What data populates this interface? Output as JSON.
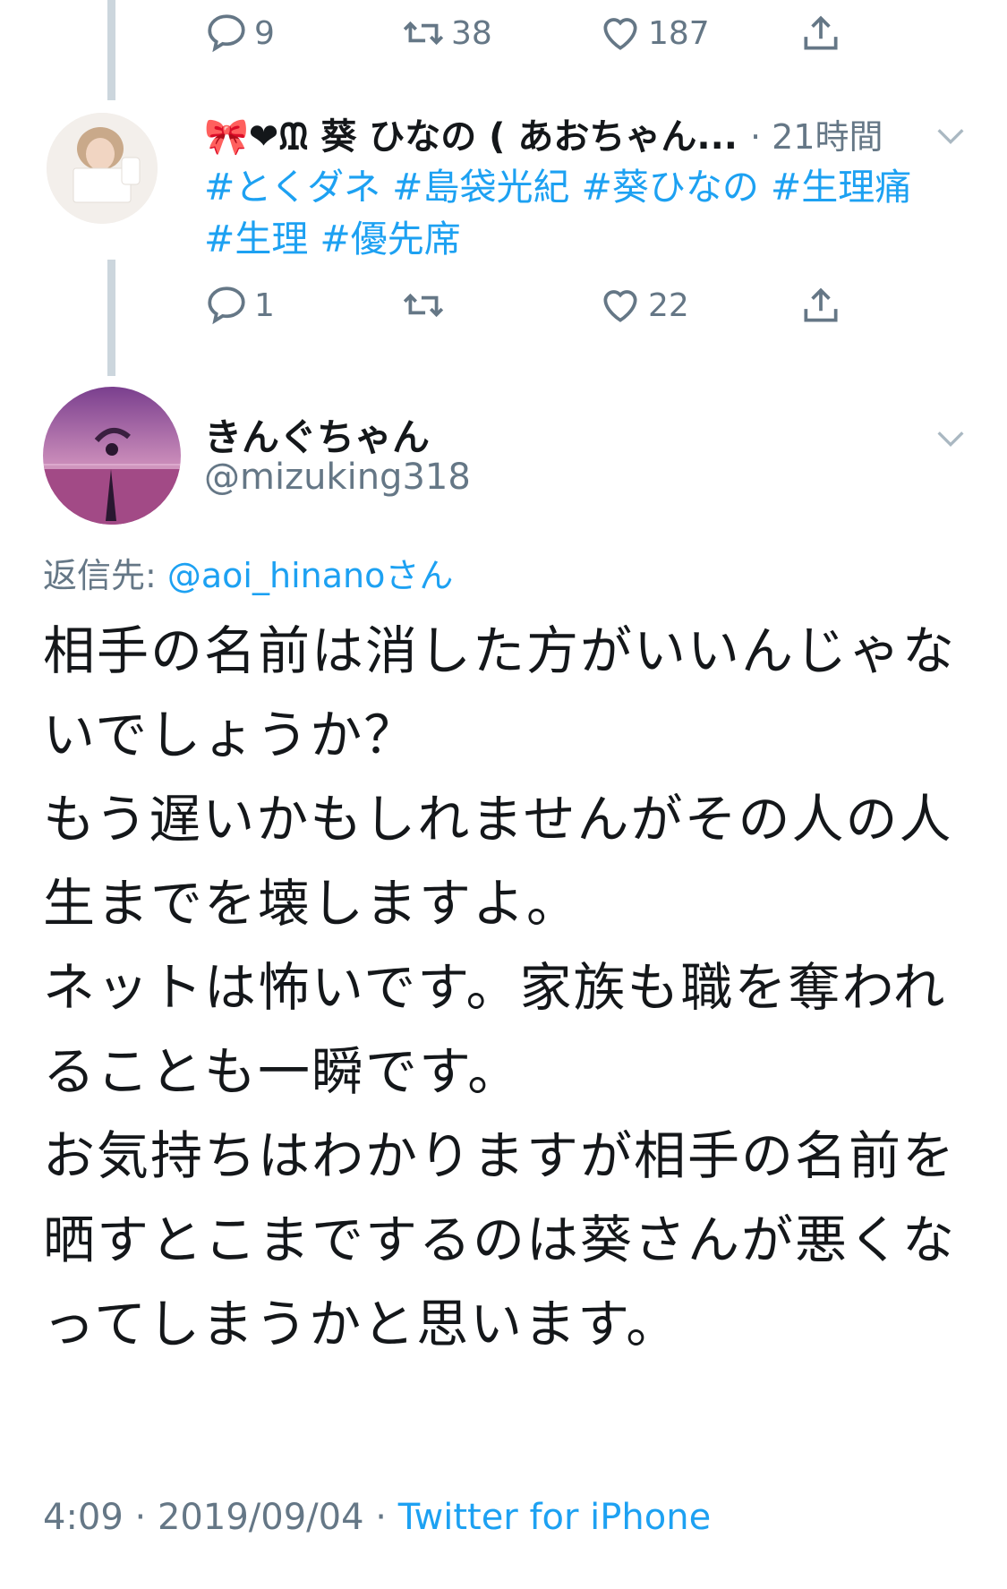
{
  "prev_tweet_actions": {
    "reply_count": "9",
    "retweet_count": "38",
    "like_count": "187"
  },
  "tweet1": {
    "author_name": "🎀❤︎ᙢ 葵 ひなの ( あおちゃん...",
    "time": "· 21時間",
    "text": "#とくダネ #島袋光紀 #葵ひなの #生理痛 #生理 #優先席",
    "reply_count": "1",
    "retweet_count": "",
    "like_count": "22"
  },
  "tweet2": {
    "author_name": "きんぐちゃん",
    "handle": "@mizuking318",
    "reply_label": "返信先: ",
    "reply_target": "@aoi_hinanoさん",
    "text": "相手の名前は消した方がいいんじゃないでしょうか？\nもう遅いかもしれませんがその人の人生までを壊しますよ。\nネットは怖いです。家族も職を奪われることも一瞬です。\nお気持ちはわかりますが相手の名前を晒すとこまでするのは葵さんが悪くなってしまうかと思います。",
    "time": "4:09",
    "date": "2019/09/04",
    "separator": "·",
    "client": "Twitter for iPhone"
  },
  "colors": {
    "link": "#1da1f2",
    "secondary_text": "#657786",
    "thread_line": "#ccd6dd"
  }
}
